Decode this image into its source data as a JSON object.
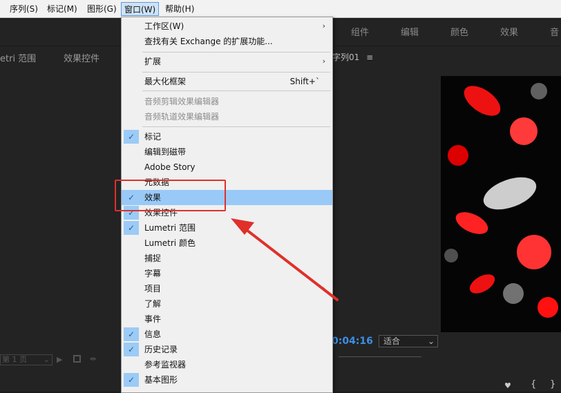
{
  "menubar": {
    "items": [
      "序列(S)",
      "标记(M)",
      "图形(G)",
      "窗口(W)",
      "帮助(H)"
    ],
    "active": "窗口(W)"
  },
  "workspace_tabs": [
    "组件",
    "编辑",
    "颜色",
    "效果",
    "音"
  ],
  "left_panel": {
    "tabs": [
      "etri 范围",
      "效果控件"
    ],
    "page_select": "第 1 页"
  },
  "program_monitor": {
    "tab": "字列01",
    "timecode": "0:04:16",
    "fit": "适合"
  },
  "window_menu": {
    "items": [
      {
        "label": "工作区(W)",
        "submenu": true,
        "checked": false
      },
      {
        "label": "查找有关 Exchange 的扩展功能...",
        "checked": false
      },
      {
        "label": "扩展",
        "submenu": true,
        "checked": false
      },
      {
        "label": "最大化框架",
        "shortcut": "Shift+`",
        "checked": false
      },
      {
        "label": "音频剪辑效果编辑器",
        "disabled": true,
        "checked": false
      },
      {
        "label": "音频轨道效果编辑器",
        "disabled": true,
        "checked": false
      },
      {
        "label": "标记",
        "checked": true
      },
      {
        "label": "编辑到磁带",
        "checked": false
      },
      {
        "label": "Adobe Story",
        "checked": false
      },
      {
        "label": "元数据",
        "checked": false
      },
      {
        "label": "效果",
        "checked": true,
        "highlighted": true
      },
      {
        "label": "效果控件",
        "checked": true
      },
      {
        "label": "Lumetri 范围",
        "checked": true
      },
      {
        "label": "Lumetri 颜色",
        "checked": false
      },
      {
        "label": "捕捉",
        "checked": false
      },
      {
        "label": "字幕",
        "checked": false
      },
      {
        "label": "项目",
        "checked": false,
        "submenu": true
      },
      {
        "label": "了解",
        "checked": false
      },
      {
        "label": "事件",
        "checked": false
      },
      {
        "label": "信息",
        "checked": true
      },
      {
        "label": "历史记录",
        "checked": true
      },
      {
        "label": "参考监视器",
        "checked": false
      },
      {
        "label": "基本图形",
        "checked": true
      }
    ]
  },
  "annotation": {
    "color": "#e0302a"
  }
}
